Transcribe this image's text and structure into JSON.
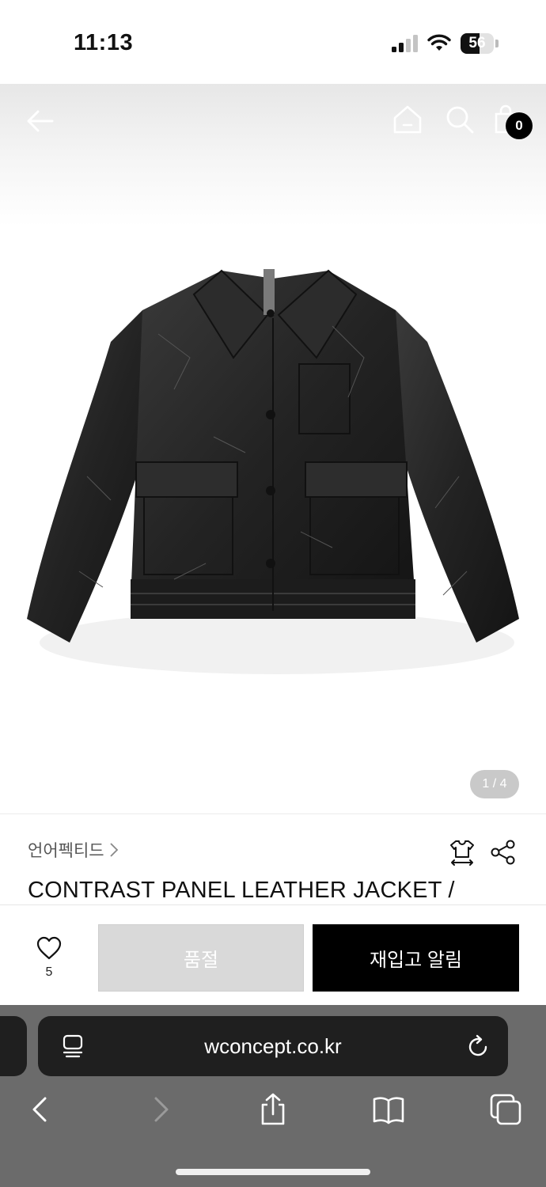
{
  "status_bar": {
    "time": "11:13",
    "battery": "56",
    "battery_level": 0.56
  },
  "nav": {
    "cart_count": "0"
  },
  "gallery": {
    "pager": "1 / 4"
  },
  "product": {
    "brand": "언어펙티드",
    "name": "CONTRAST PANEL LEATHER JACKET /"
  },
  "actions": {
    "like_count": "5",
    "soldout_label": "품절",
    "restock_label": "재입고 알림"
  },
  "browser": {
    "url": "wconcept.co.kr"
  },
  "icons": {
    "back": "arrow-left-icon",
    "home": "home-icon",
    "search": "search-icon",
    "cart": "cart-icon",
    "size": "size-guide-icon",
    "share": "share-icon",
    "like": "heart-icon",
    "reader": "reader-icon",
    "reload": "reload-icon"
  }
}
